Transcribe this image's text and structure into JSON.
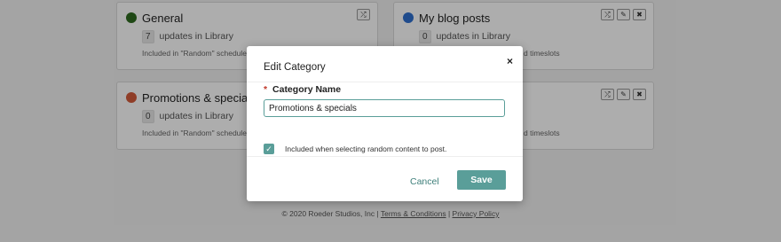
{
  "cards": [
    {
      "title": "General",
      "dot_color": "#2e6b1f",
      "count": "7",
      "count_text": "updates in Library",
      "note": "Included in \"Random\" schedule"
    },
    {
      "title": "My blog posts",
      "dot_color": "#2f6fcf",
      "count": "0",
      "count_text": "updates in Library",
      "note": "d timeslots"
    },
    {
      "title": "Promotions & specials",
      "dot_color": "#d35a3a",
      "count": "0",
      "count_text": "updates in Library",
      "note": "Included in \"Random\" schedule"
    },
    {
      "note": "d timeslots"
    }
  ],
  "footer": {
    "copyright": "© 2020 Roeder Studios, Inc |",
    "terms": "Terms & Conditions",
    "separator": "|",
    "privacy": "Privacy Policy"
  },
  "modal": {
    "title": "Edit Category",
    "close_glyph": "×",
    "field_required_marker": "*",
    "field_label": "Category Name",
    "field_value": "Promotions & specials",
    "checkbox_checked": true,
    "checkbox_label": "Included when selecting random content to post.",
    "cancel_label": "Cancel",
    "save_label": "Save"
  },
  "icons": {
    "shuffle": "⤮",
    "edit": "✎",
    "delete": "✖",
    "check": "✓"
  },
  "colors": {
    "accent": "#5a9e99",
    "required": "#c0392b"
  }
}
